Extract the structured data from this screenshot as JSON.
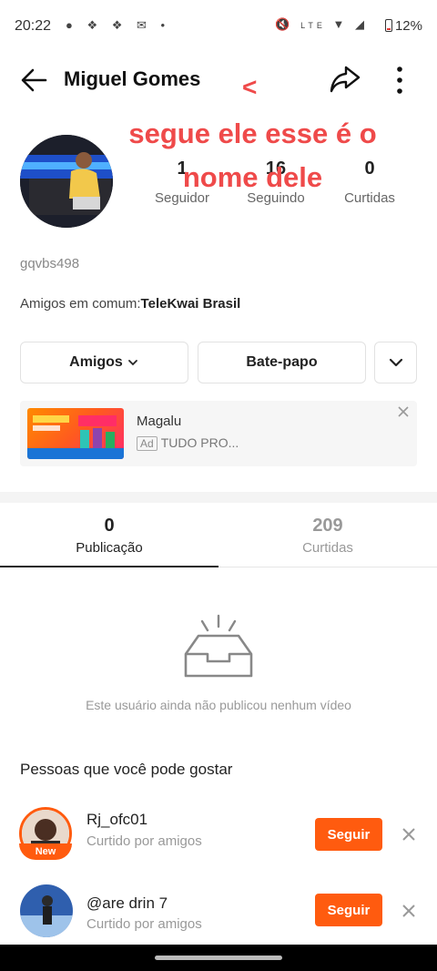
{
  "status_bar": {
    "time": "20:22",
    "battery": "12%",
    "network_label": "LTE"
  },
  "header": {
    "title": "Miguel Gomes"
  },
  "overlay": {
    "arrow": "<",
    "text_line1": "segue ele esse é o",
    "text_line2": "nome dele",
    "color": "#ef4a4a"
  },
  "profile": {
    "stats": [
      {
        "value": "1",
        "label": "Seguidor"
      },
      {
        "value": "16",
        "label": "Seguindo"
      },
      {
        "value": "0",
        "label": "Curtidas"
      }
    ],
    "handle": "gqvbs498",
    "mutual_label": "Amigos em comum:",
    "mutual_name": "TeleKwai Brasil"
  },
  "actions": {
    "friends_label": "Amigos",
    "chat_label": "Bate-papo"
  },
  "ad": {
    "title": "Magalu",
    "badge": "Ad",
    "subtitle": "TUDO PRO..."
  },
  "tabs": [
    {
      "count": "0",
      "label": "Publicação",
      "active": true
    },
    {
      "count": "209",
      "label": "Curtidas",
      "active": false
    }
  ],
  "empty_state": {
    "text": "Este usuário ainda não publicou nenhum vídeo"
  },
  "suggestions": {
    "title": "Pessoas que você pode gostar",
    "follow_label": "Seguir",
    "new_badge": "New",
    "people": [
      {
        "name": "Rj_ofc01",
        "subtitle": "Curtido por amigos"
      },
      {
        "name": "@are  drin 7",
        "subtitle": "Curtido por amigos"
      }
    ]
  },
  "colors": {
    "accent": "#ff5b0f",
    "overlay_text": "#ef4a4a"
  }
}
